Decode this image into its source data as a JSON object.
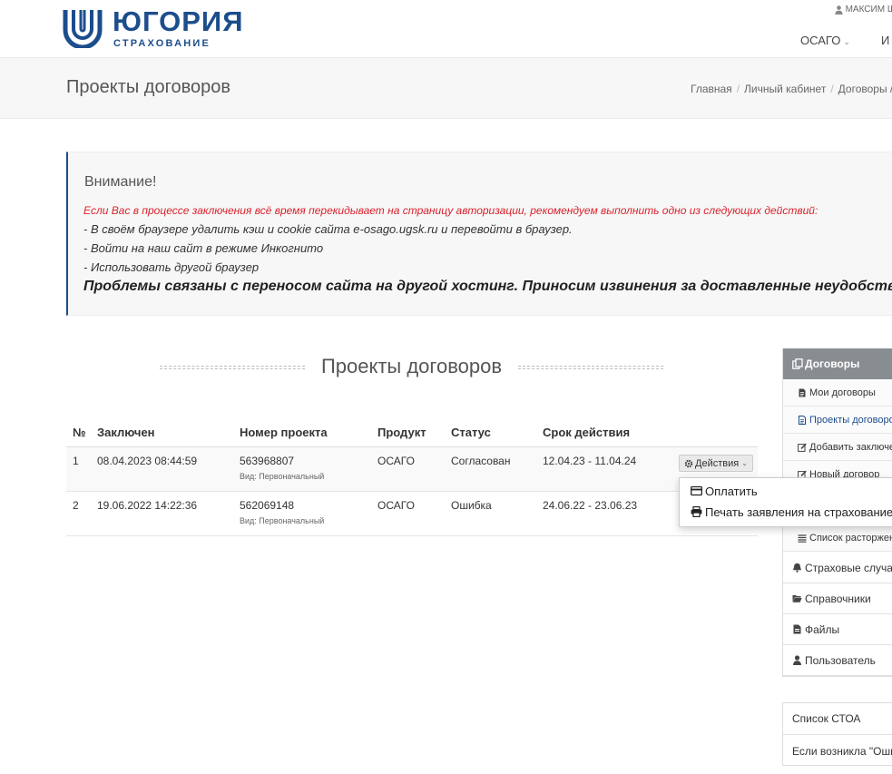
{
  "header": {
    "brand": "ЮГОРИЯ",
    "brand_sub": "СТРАХОВАНИЕ",
    "user_name": "МАКСИМ Ш",
    "nav": [
      {
        "label": "ОСАГО"
      },
      {
        "label": "И"
      }
    ]
  },
  "titlebar": {
    "title": "Проекты договоров",
    "breadcrumb": [
      "Главная",
      "Личный кабинет",
      "Договоры /"
    ]
  },
  "alert": {
    "title": "Внимание!",
    "red_line": "Если Вас в процессе заключения всё время перекидывает на страницу авторизации, рекомендуем выполнить одно из следующих действий:",
    "lines": [
      "- В своём браузере удалить кэш и cookie сайта e-osago.ugsk.ru и перевойти в браузер.",
      "- Войти на наш сайт в режиме Инкогнито",
      "- Использовать другой браузер"
    ],
    "bold_line": "Проблемы связаны с переносом сайта на другой хостинг. Приносим извинения за доставленные неудобства"
  },
  "section": {
    "title": "Проекты договоров"
  },
  "table": {
    "headers": [
      "№",
      "Заключен",
      "Номер проекта",
      "Продукт",
      "Статус",
      "Срок действия"
    ],
    "rows": [
      {
        "num": "1",
        "date": "08.04.2023 08:44:59",
        "project": "563968807",
        "kind": "Вид: Первоначальный",
        "product": "ОСАГО",
        "status": "Согласован",
        "term": "12.04.23 - 11.04.24"
      },
      {
        "num": "2",
        "date": "19.06.2022 14:22:36",
        "project": "562069148",
        "kind": "Вид: Первоначальный",
        "product": "ОСАГО",
        "status": "Ошибка",
        "term": "24.06.22 - 23.06.23"
      }
    ],
    "actions_label": "Действия"
  },
  "dropdown": {
    "items": [
      {
        "label": "Оплатить",
        "icon": "credit-card-icon"
      },
      {
        "label": "Печать заявления на страхование",
        "icon": "printer-icon"
      }
    ]
  },
  "sidebar": {
    "header": "Договоры",
    "sub_items": [
      {
        "label": "Мои договоры"
      },
      {
        "label": "Проекты договоров"
      },
      {
        "label": "Добавить заключенный"
      },
      {
        "label": "Новый договор"
      },
      {
        "label": "Список расторжений"
      }
    ],
    "main_items": [
      {
        "label": "Страховые случаи"
      },
      {
        "label": "Справочники"
      },
      {
        "label": "Файлы"
      },
      {
        "label": "Пользователь"
      }
    ],
    "links": [
      {
        "label": "Список СТОА"
      },
      {
        "label": "Если возникла \"Ошибка\""
      }
    ]
  },
  "colors": {
    "brand": "#1c4d8c",
    "alert_red": "#d9232d",
    "sidebar_header": "#888d92"
  }
}
